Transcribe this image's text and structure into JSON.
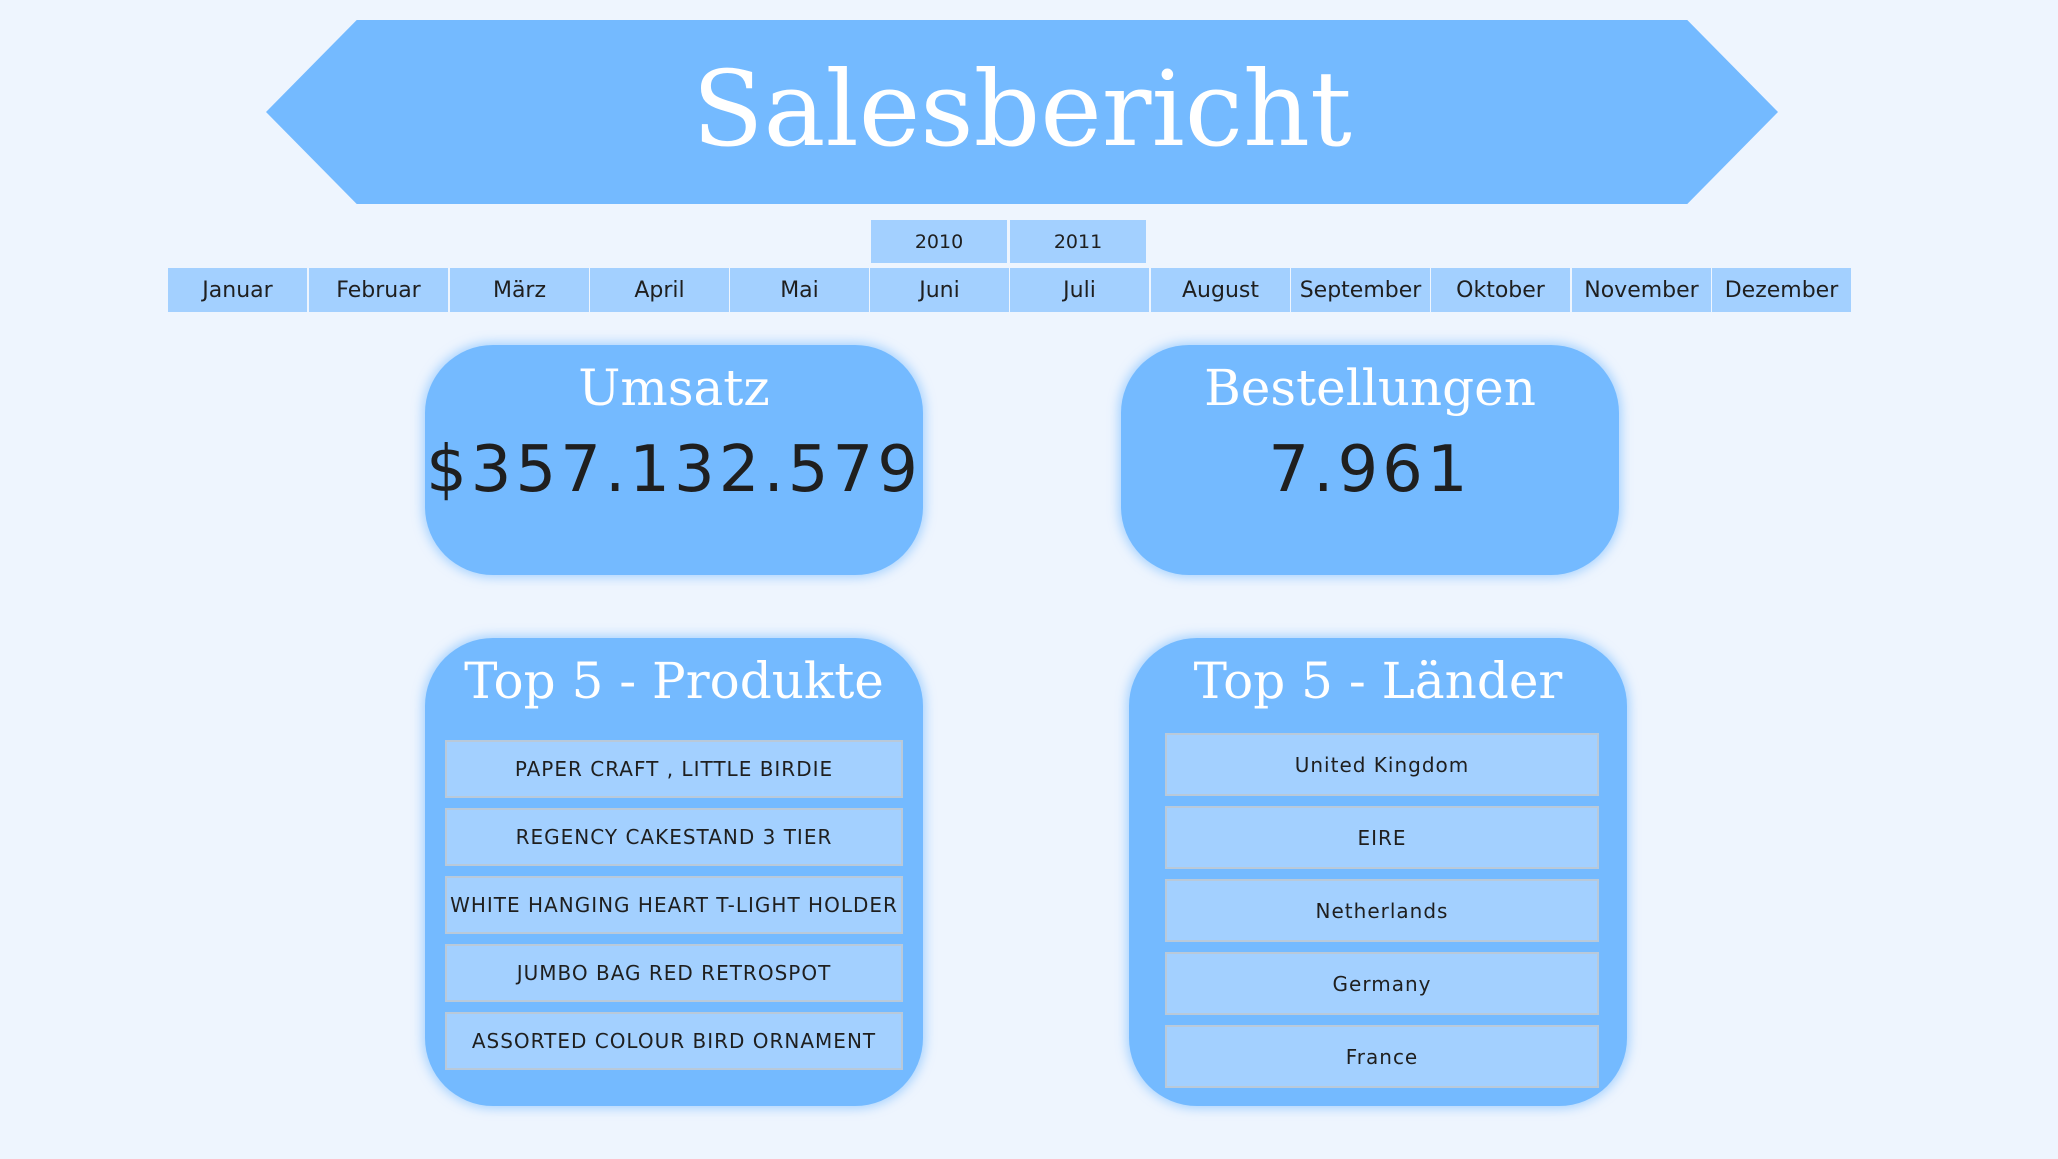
{
  "header": {
    "title": "Salesbericht"
  },
  "year_slicer": [
    "2010",
    "2011"
  ],
  "month_slicer": [
    "Januar",
    "Februar",
    "März",
    "April",
    "Mai",
    "Juni",
    "Juli",
    "August",
    "September",
    "Oktober",
    "November",
    "Dezember"
  ],
  "kpis": {
    "revenue": {
      "title": "Umsatz",
      "value": "$357.132.579"
    },
    "orders": {
      "title": "Bestellungen",
      "value": "7.961"
    }
  },
  "top_products": {
    "title": "Top 5 - Produkte",
    "items": [
      "PAPER CRAFT , LITTLE BIRDIE",
      "REGENCY CAKESTAND 3 TIER",
      "WHITE HANGING HEART T-LIGHT HOLDER",
      "JUMBO BAG RED RETROSPOT",
      "ASSORTED COLOUR BIRD ORNAMENT"
    ]
  },
  "top_countries": {
    "title": "Top 5 - Länder",
    "items": [
      "United Kingdom",
      "EIRE",
      "Netherlands",
      "Germany",
      "France"
    ]
  },
  "colors": {
    "background": "#eef5fe",
    "primary": "#74baff",
    "button": "#a3d0ff",
    "text_dark": "#1f1f1f",
    "text_light": "#ffffff"
  }
}
